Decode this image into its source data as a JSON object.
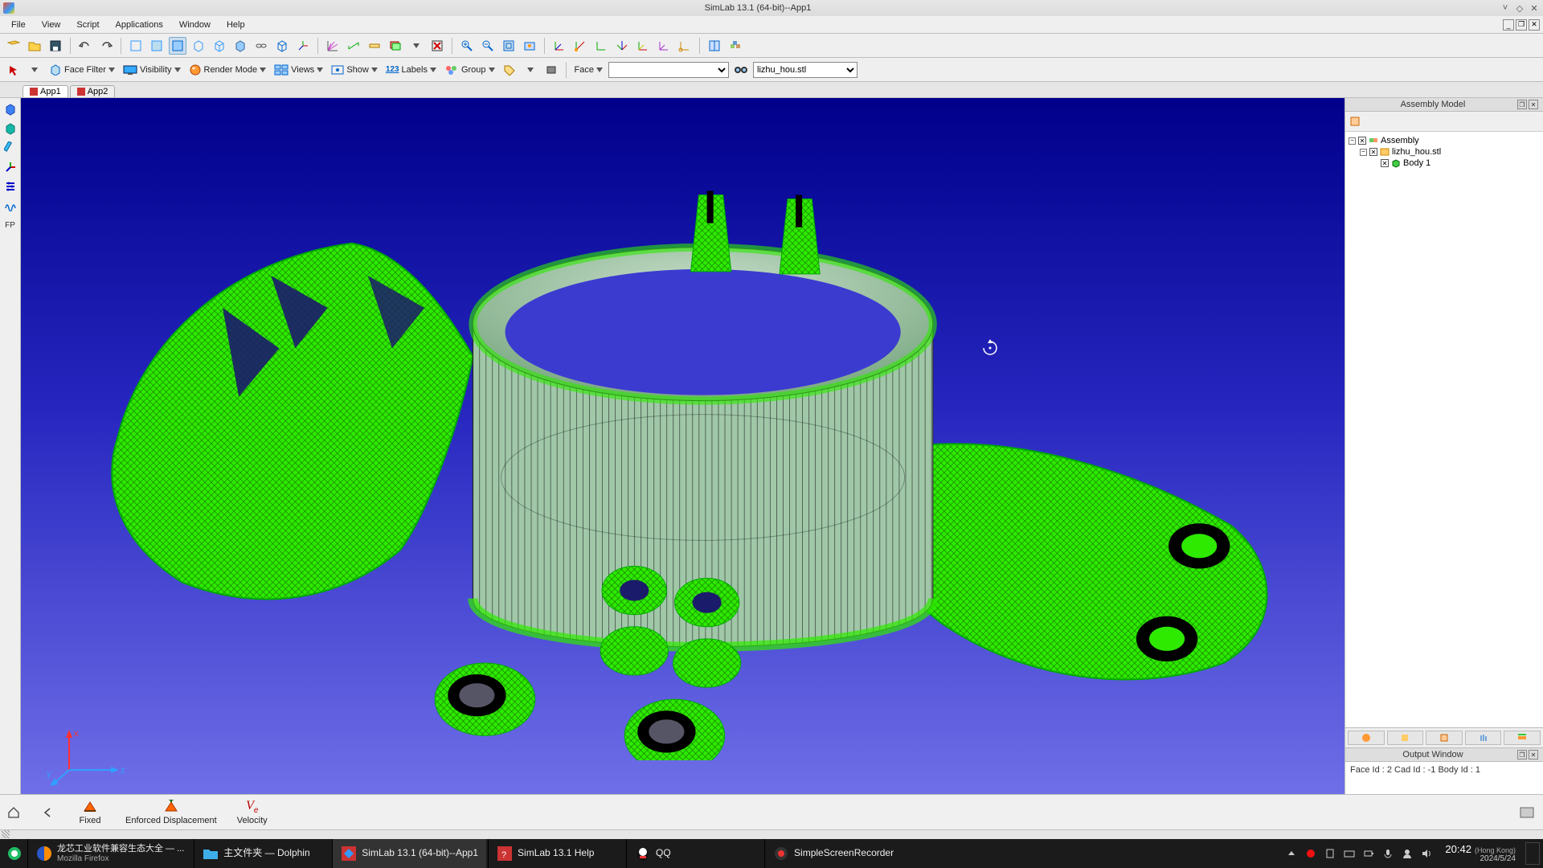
{
  "window": {
    "title": "SimLab 13.1 (64-bit)--App1"
  },
  "menu": {
    "items": [
      "File",
      "View",
      "Script",
      "Applications",
      "Window",
      "Help"
    ]
  },
  "toolbar2": {
    "face_filter": "Face Filter",
    "visibility": "Visibility",
    "render_mode": "Render Mode",
    "views": "Views",
    "show": "Show",
    "labels": "Labels",
    "group": "Group",
    "face_label": "Face",
    "combo_value": "",
    "model_combo": "lizhu_hou.stl"
  },
  "tabs": [
    "App1",
    "App2"
  ],
  "leftstrip": {
    "fp_label": "FP"
  },
  "triad": {
    "x": "x",
    "y": "y",
    "z": "z"
  },
  "assembly_panel": {
    "title": "Assembly Model",
    "tree": {
      "root": "Assembly",
      "file": "lizhu_hou.stl",
      "body": "Body 1"
    }
  },
  "output_panel": {
    "title": "Output Window",
    "line1": "Face Id : 2 Cad Id : -1 Body Id : 1"
  },
  "commands": {
    "fixed": "Fixed",
    "enforced": "Enforced Displacement",
    "velocity": "Velocity"
  },
  "taskbar": {
    "firefox_line1": "龙芯工业软件兼容生态大全 — ...",
    "firefox_line2": "Mozilla Firefox",
    "dolphin": "主文件夹 — Dolphin",
    "simlab_app": "SimLab 13.1 (64-bit)--App1",
    "simlab_help": "SimLab 13.1 Help",
    "qq": "QQ",
    "ssr": "SimpleScreenRecorder",
    "time": "20:42",
    "tz": "(Hong Kong)",
    "date": "2024/5/24"
  }
}
